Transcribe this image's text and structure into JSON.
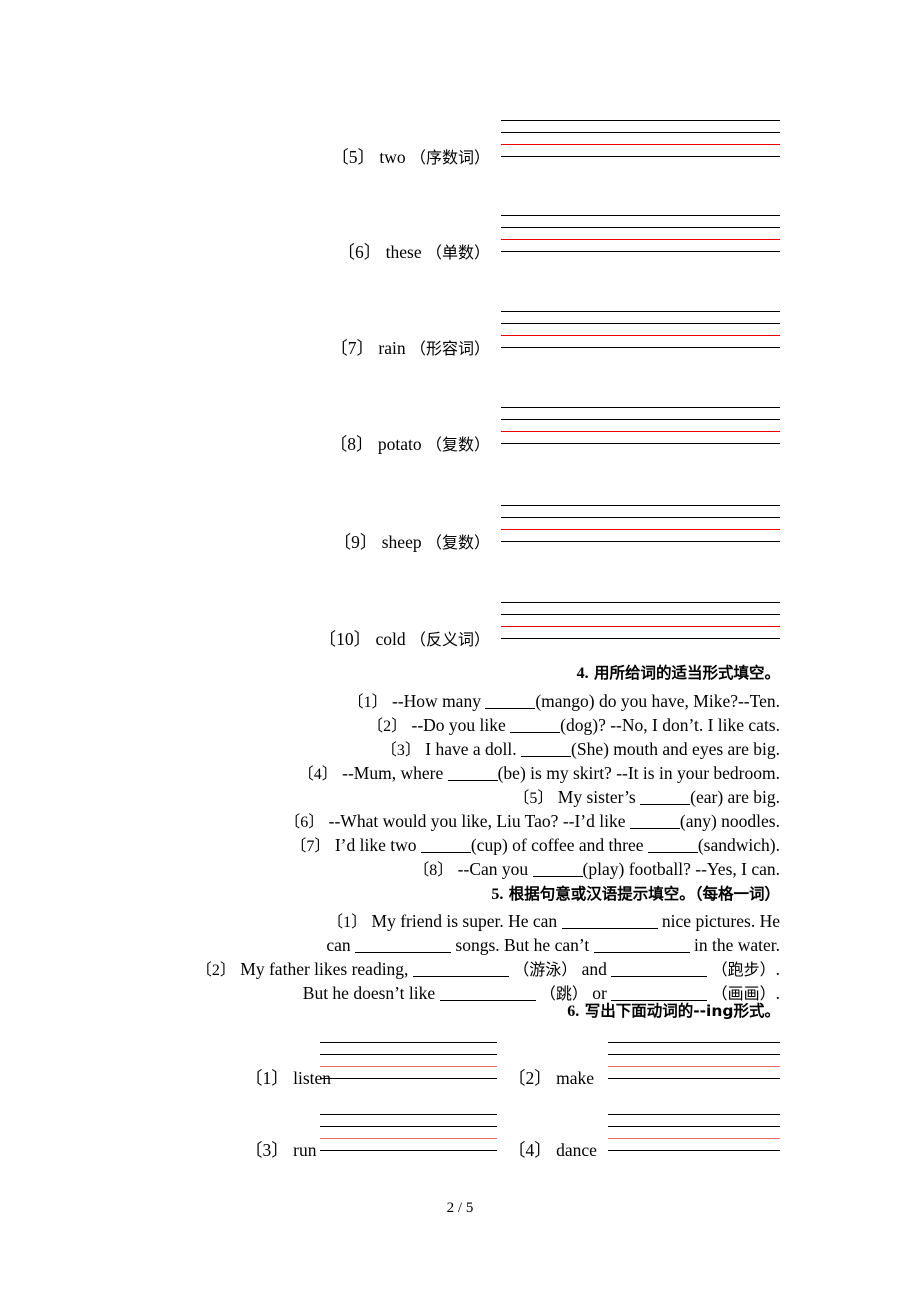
{
  "page": {
    "footer": "2 / 5",
    "accent_red": "#ee0000",
    "accent_red_light": "#f26b6b",
    "ink": "#000000"
  },
  "word_form_items": [
    {
      "index": "〔5〕",
      "word": "two",
      "hint": "（序数词）"
    },
    {
      "index": "〔6〕",
      "word": "these",
      "hint": "（单数）"
    },
    {
      "index": "〔7〕",
      "word": "rain",
      "hint": "（形容词）"
    },
    {
      "index": "〔8〕",
      "word": "potato",
      "hint": "（复数）"
    },
    {
      "index": "〔9〕",
      "word": "sheep",
      "hint": "（复数）"
    },
    {
      "index": "〔10〕",
      "word": "cold",
      "hint": "（反义词）"
    }
  ],
  "section4": {
    "number": "4.",
    "title": "用所给词的适当形式填空。",
    "items": [
      {
        "index": "〔1〕",
        "before": "--How many",
        "after": "(mango) do you have, Mike?--Ten."
      },
      {
        "index": "〔2〕",
        "before": "--Do you like",
        "after": "(dog)? --No, I don’t. I like cats."
      },
      {
        "index": "〔3〕",
        "before": "I have a doll.",
        "after": "(She) mouth and eyes are big."
      },
      {
        "index": "〔4〕",
        "before": "--Mum, where",
        "after": "(be) is my skirt? --It is in your bedroom."
      },
      {
        "index": "〔5〕",
        "before": "My sister’s",
        "after": "(ear) are big."
      },
      {
        "index": "〔6〕",
        "before": "--What would you like, Liu Tao? --I’d like",
        "after": "(any) noodles."
      },
      {
        "index": "〔7〕",
        "before": "I’d like two",
        "middle": "(cup) of coffee and three",
        "after": "(sandwich)."
      },
      {
        "index": "〔8〕",
        "before": "--Can you",
        "after": "(play) football? --Yes, I can."
      }
    ]
  },
  "section5": {
    "number": "5.",
    "title": "根据句意或汉语提示填空。（每格一词）",
    "line1": {
      "index": "〔1〕",
      "a": "My friend is super. He can",
      "b": "nice pictures. He"
    },
    "line2": {
      "a": "can",
      "b": "songs. But he can’t",
      "c": "in the water."
    },
    "line3": {
      "index": "〔2〕",
      "a": "My father likes reading,",
      "hint1": "（游泳）",
      "b": "and",
      "hint2": "（跑步）",
      "c": "."
    },
    "line4": {
      "a": "But he doesn’t like",
      "hint1": "（跳）",
      "b": "or",
      "hint2": "（画画）",
      "c": "."
    }
  },
  "section6": {
    "number": "6.",
    "title": "写出下面动词的--ing形式。",
    "items": [
      {
        "index": "〔1〕",
        "word": "listen"
      },
      {
        "index": "〔2〕",
        "word": "make"
      },
      {
        "index": "〔3〕",
        "word": "run"
      },
      {
        "index": "〔4〕",
        "word": "dance"
      }
    ]
  }
}
